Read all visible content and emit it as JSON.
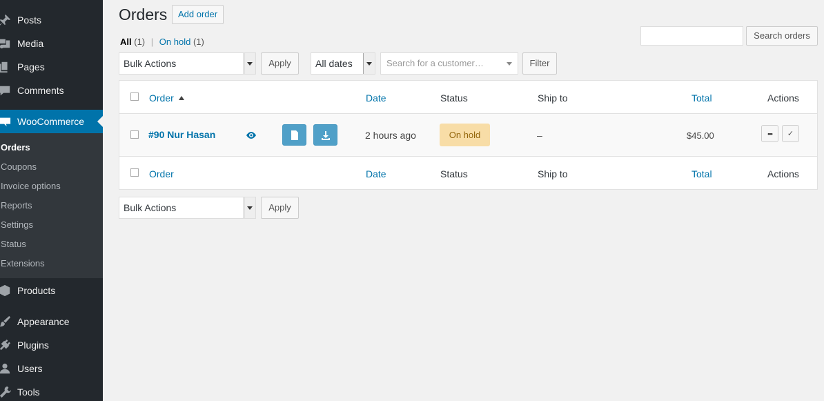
{
  "sidebar": {
    "items": [
      {
        "label": "Posts",
        "icon": "pin-icon"
      },
      {
        "label": "Media",
        "icon": "media-icon"
      },
      {
        "label": "Pages",
        "icon": "pages-icon"
      },
      {
        "label": "Comments",
        "icon": "comment-icon"
      },
      {
        "label": "WooCommerce",
        "icon": "woo-icon"
      },
      {
        "label": "Products",
        "icon": "products-icon"
      },
      {
        "label": "Appearance",
        "icon": "brush-icon"
      },
      {
        "label": "Plugins",
        "icon": "plugin-icon"
      },
      {
        "label": "Users",
        "icon": "user-icon"
      },
      {
        "label": "Tools",
        "icon": "wrench-icon"
      }
    ],
    "woo_submenu": [
      "Orders",
      "Coupons",
      "Invoice options",
      "Reports",
      "Settings",
      "Status",
      "Extensions"
    ],
    "woo_badge": "woo"
  },
  "header": {
    "title": "Orders",
    "add_label": "Add order"
  },
  "filters": {
    "all_label": "All",
    "all_count": "(1)",
    "sep": "|",
    "onhold_label": "On hold",
    "onhold_count": "(1)"
  },
  "search": {
    "button": "Search orders",
    "value": ""
  },
  "toolbar": {
    "bulk_actions": "Bulk Actions",
    "apply": "Apply",
    "dates": "All dates",
    "customer_placeholder": "Search for a customer…",
    "filter": "Filter"
  },
  "table": {
    "columns": {
      "order": "Order",
      "date": "Date",
      "status": "Status",
      "ship_to": "Ship to",
      "total": "Total",
      "actions": "Actions"
    },
    "rows": [
      {
        "order": "#90 Nur Hasan",
        "date": "2 hours ago",
        "status": "On hold",
        "ship_to": "–",
        "total": "$45.00",
        "more": "•••",
        "complete": "✓"
      }
    ]
  },
  "colors": {
    "sidebar": "#23282d",
    "accent": "#0073aa",
    "onhold_bg": "#f8dda7",
    "onhold_text": "#94660c"
  }
}
